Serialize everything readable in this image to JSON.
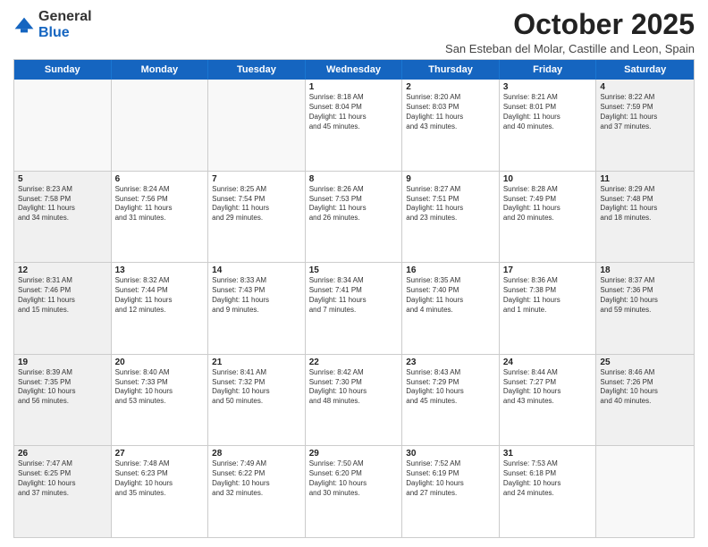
{
  "header": {
    "logo_general": "General",
    "logo_blue": "Blue",
    "month_title": "October 2025",
    "subtitle": "San Esteban del Molar, Castille and Leon, Spain"
  },
  "days_of_week": [
    "Sunday",
    "Monday",
    "Tuesday",
    "Wednesday",
    "Thursday",
    "Friday",
    "Saturday"
  ],
  "weeks": [
    {
      "cells": [
        {
          "day": "",
          "text": "",
          "empty": true
        },
        {
          "day": "",
          "text": "",
          "empty": true
        },
        {
          "day": "",
          "text": "",
          "empty": true
        },
        {
          "day": "1",
          "text": "Sunrise: 8:18 AM\nSunset: 8:04 PM\nDaylight: 11 hours\nand 45 minutes."
        },
        {
          "day": "2",
          "text": "Sunrise: 8:20 AM\nSunset: 8:03 PM\nDaylight: 11 hours\nand 43 minutes."
        },
        {
          "day": "3",
          "text": "Sunrise: 8:21 AM\nSunset: 8:01 PM\nDaylight: 11 hours\nand 40 minutes."
        },
        {
          "day": "4",
          "text": "Sunrise: 8:22 AM\nSunset: 7:59 PM\nDaylight: 11 hours\nand 37 minutes.",
          "shaded": true
        }
      ]
    },
    {
      "cells": [
        {
          "day": "5",
          "text": "Sunrise: 8:23 AM\nSunset: 7:58 PM\nDaylight: 11 hours\nand 34 minutes.",
          "shaded": true
        },
        {
          "day": "6",
          "text": "Sunrise: 8:24 AM\nSunset: 7:56 PM\nDaylight: 11 hours\nand 31 minutes."
        },
        {
          "day": "7",
          "text": "Sunrise: 8:25 AM\nSunset: 7:54 PM\nDaylight: 11 hours\nand 29 minutes."
        },
        {
          "day": "8",
          "text": "Sunrise: 8:26 AM\nSunset: 7:53 PM\nDaylight: 11 hours\nand 26 minutes."
        },
        {
          "day": "9",
          "text": "Sunrise: 8:27 AM\nSunset: 7:51 PM\nDaylight: 11 hours\nand 23 minutes."
        },
        {
          "day": "10",
          "text": "Sunrise: 8:28 AM\nSunset: 7:49 PM\nDaylight: 11 hours\nand 20 minutes."
        },
        {
          "day": "11",
          "text": "Sunrise: 8:29 AM\nSunset: 7:48 PM\nDaylight: 11 hours\nand 18 minutes.",
          "shaded": true
        }
      ]
    },
    {
      "cells": [
        {
          "day": "12",
          "text": "Sunrise: 8:31 AM\nSunset: 7:46 PM\nDaylight: 11 hours\nand 15 minutes.",
          "shaded": true
        },
        {
          "day": "13",
          "text": "Sunrise: 8:32 AM\nSunset: 7:44 PM\nDaylight: 11 hours\nand 12 minutes."
        },
        {
          "day": "14",
          "text": "Sunrise: 8:33 AM\nSunset: 7:43 PM\nDaylight: 11 hours\nand 9 minutes."
        },
        {
          "day": "15",
          "text": "Sunrise: 8:34 AM\nSunset: 7:41 PM\nDaylight: 11 hours\nand 7 minutes."
        },
        {
          "day": "16",
          "text": "Sunrise: 8:35 AM\nSunset: 7:40 PM\nDaylight: 11 hours\nand 4 minutes."
        },
        {
          "day": "17",
          "text": "Sunrise: 8:36 AM\nSunset: 7:38 PM\nDaylight: 11 hours\nand 1 minute."
        },
        {
          "day": "18",
          "text": "Sunrise: 8:37 AM\nSunset: 7:36 PM\nDaylight: 10 hours\nand 59 minutes.",
          "shaded": true
        }
      ]
    },
    {
      "cells": [
        {
          "day": "19",
          "text": "Sunrise: 8:39 AM\nSunset: 7:35 PM\nDaylight: 10 hours\nand 56 minutes.",
          "shaded": true
        },
        {
          "day": "20",
          "text": "Sunrise: 8:40 AM\nSunset: 7:33 PM\nDaylight: 10 hours\nand 53 minutes."
        },
        {
          "day": "21",
          "text": "Sunrise: 8:41 AM\nSunset: 7:32 PM\nDaylight: 10 hours\nand 50 minutes."
        },
        {
          "day": "22",
          "text": "Sunrise: 8:42 AM\nSunset: 7:30 PM\nDaylight: 10 hours\nand 48 minutes."
        },
        {
          "day": "23",
          "text": "Sunrise: 8:43 AM\nSunset: 7:29 PM\nDaylight: 10 hours\nand 45 minutes."
        },
        {
          "day": "24",
          "text": "Sunrise: 8:44 AM\nSunset: 7:27 PM\nDaylight: 10 hours\nand 43 minutes."
        },
        {
          "day": "25",
          "text": "Sunrise: 8:46 AM\nSunset: 7:26 PM\nDaylight: 10 hours\nand 40 minutes.",
          "shaded": true
        }
      ]
    },
    {
      "cells": [
        {
          "day": "26",
          "text": "Sunrise: 7:47 AM\nSunset: 6:25 PM\nDaylight: 10 hours\nand 37 minutes.",
          "shaded": true
        },
        {
          "day": "27",
          "text": "Sunrise: 7:48 AM\nSunset: 6:23 PM\nDaylight: 10 hours\nand 35 minutes."
        },
        {
          "day": "28",
          "text": "Sunrise: 7:49 AM\nSunset: 6:22 PM\nDaylight: 10 hours\nand 32 minutes."
        },
        {
          "day": "29",
          "text": "Sunrise: 7:50 AM\nSunset: 6:20 PM\nDaylight: 10 hours\nand 30 minutes."
        },
        {
          "day": "30",
          "text": "Sunrise: 7:52 AM\nSunset: 6:19 PM\nDaylight: 10 hours\nand 27 minutes."
        },
        {
          "day": "31",
          "text": "Sunrise: 7:53 AM\nSunset: 6:18 PM\nDaylight: 10 hours\nand 24 minutes."
        },
        {
          "day": "",
          "text": "",
          "empty": true
        }
      ]
    }
  ]
}
